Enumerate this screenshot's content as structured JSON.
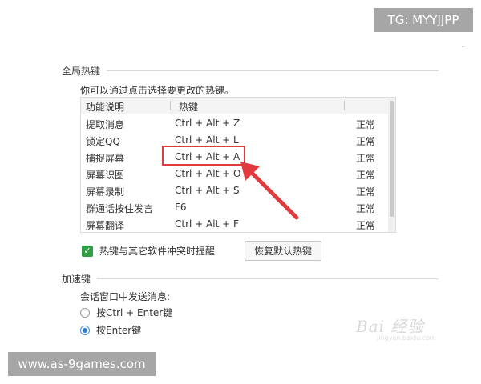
{
  "watermarks": {
    "tg": "TG: MYYJJPP",
    "website": "www.as-9games.com",
    "baidu": "Bai 经验",
    "baidu_sub": "jingyan.baidu.com"
  },
  "global_hotkeys": {
    "group_title": "全局热键",
    "description": "你可以通过点击选择要更改的热键。",
    "columns": [
      "功能说明",
      "热键"
    ],
    "rows": [
      {
        "function": "提取消息",
        "hotkey": "Ctrl + Alt + Z",
        "status": "正常"
      },
      {
        "function": "锁定QQ",
        "hotkey": "Ctrl + Alt + L",
        "status": "正常"
      },
      {
        "function": "捕捉屏幕",
        "hotkey": "Ctrl + Alt + A",
        "status": "正常"
      },
      {
        "function": "屏幕识图",
        "hotkey": "Ctrl + Alt + O",
        "status": "正常"
      },
      {
        "function": "屏幕录制",
        "hotkey": "Ctrl + Alt + S",
        "status": "正常"
      },
      {
        "function": "群通话按住发言",
        "hotkey": "F6",
        "status": "正常"
      },
      {
        "function": "屏幕翻译",
        "hotkey": "Ctrl + Alt + F",
        "status": "正常"
      }
    ],
    "conflict_checkbox_label": "热键与其它软件冲突时提醒",
    "conflict_checked": true,
    "restore_button_label": "恢复默认热键"
  },
  "accelerator_keys": {
    "group_title": "加速键",
    "description": "会话窗口中发送消息:",
    "options": [
      {
        "label": "按Ctrl + Enter键",
        "selected": false
      },
      {
        "label": "按Enter键",
        "selected": true
      }
    ]
  },
  "colors": {
    "highlight": "#e0393e",
    "checkbox": "#2f9e44",
    "radio_selected": "#2f7fd1"
  }
}
